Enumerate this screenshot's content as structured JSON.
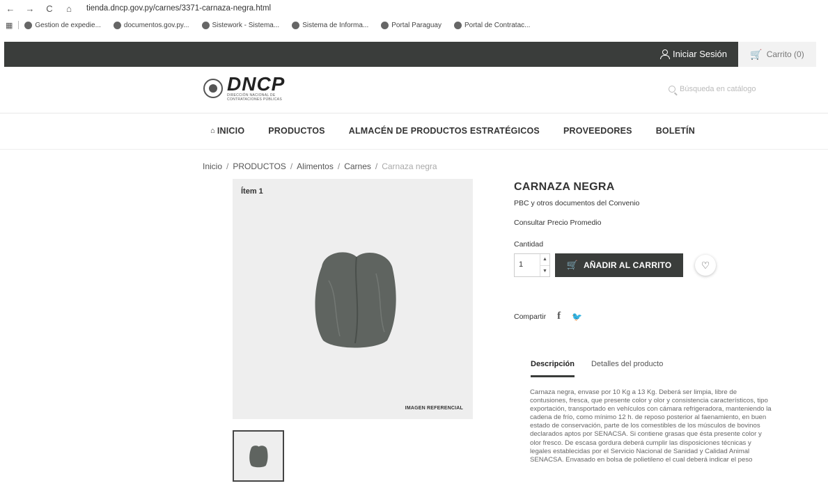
{
  "browser": {
    "back": "←",
    "forward": "→",
    "reload": "C",
    "home": "⌂",
    "url": "tienda.dncp.gov.py/carnes/3371-carnaza-negra.html"
  },
  "bookmarks": [
    "Gestion de expedie...",
    "documentos.gov.py...",
    "Sistework - Sistema...",
    "Sistema de Informa...",
    "Portal Paraguay",
    "Portal de Contratac..."
  ],
  "topbar": {
    "login_label": "Iniciar Sesión",
    "cart_label": "Carrito (0)"
  },
  "header": {
    "logo_text": "DNCP",
    "logo_subtitle": "DIRECCIÓN NACIONAL DE CONTRATACIONES PÚBLICAS",
    "search_placeholder": "Búsqueda en catálogo"
  },
  "nav": {
    "items": [
      "INICIO",
      "PRODUCTOS",
      "ALMACÉN DE PRODUCTOS ESTRATÉGICOS",
      "PROVEEDORES",
      "BOLETÍN"
    ]
  },
  "breadcrumb": {
    "items": [
      "Inicio",
      "PRODUCTOS",
      "Alimentos",
      "Carnes",
      "Carnaza negra"
    ],
    "separator": "/"
  },
  "product": {
    "item_label": "Ítem 1",
    "image_caption": "IMAGEN REFERENCIAL",
    "title": "CARNAZA NEGRA",
    "pbc_link": "PBC y otros documentos del Convenio",
    "precio_link": "Consultar Precio Promedio",
    "quantity_label": "Cantidad",
    "quantity_value": "1",
    "add_to_cart": "AÑADIR AL CARRITO",
    "share_label": "Compartir"
  },
  "tabs": {
    "description": "Descripción",
    "details": "Detalles del producto"
  },
  "description_text": "Carnaza negra, envase por 10 Kg a 13 Kg. Deberá ser limpia, libre de contusiones, fresca, que presente color y olor y consistencia característicos, tipo exportación, transportado en vehículos con cámara refrigeradora, manteniendo la cadena de frío, como mínimo 12 h. de reposo posterior al faenamiento, en buen estado de conservación, parte de los comestibles de los músculos de bovinos declarados aptos por SENACSA. Si contiene grasas que ésta presente color y olor fresco. De escasa gordura deberá cumplir las disposiciones técnicas y legales establecidas por el Servicio Nacional de Sanidad y Calidad Animal SENACSA. Envasado en bolsa de polietileno el cual deberá indicar el peso"
}
